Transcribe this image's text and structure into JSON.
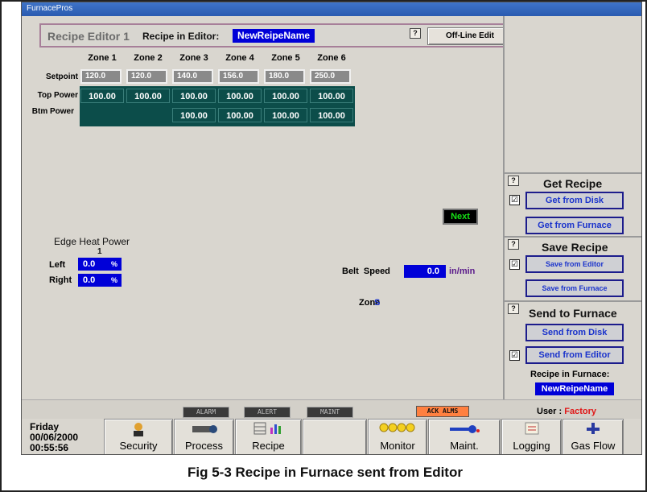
{
  "app": {
    "title": "FurnacePros"
  },
  "editor": {
    "title": "Recipe Editor 1",
    "recipe_label": "Recipe in Editor:",
    "recipe_name": "NewReipeName",
    "help": "?",
    "offline_button": "Off-Line Edit"
  },
  "zones": {
    "headers": [
      "Zone 1",
      "Zone 2",
      "Zone 3",
      "Zone 4",
      "Zone 5",
      "Zone 6"
    ],
    "row_labels": {
      "setpoint": "Setpoint",
      "top_power": "Top Power",
      "btm_power": "Btm Power"
    },
    "setpoint": [
      "120.0",
      "120.0",
      "140.0",
      "156.0",
      "180.0",
      "250.0"
    ],
    "top_power": [
      "100.00",
      "100.00",
      "100.00",
      "100.00",
      "100.00",
      "100.00"
    ],
    "btm_power": [
      "",
      "",
      "100.00",
      "100.00",
      "100.00",
      "100.00"
    ]
  },
  "next_button": "Next",
  "edge_heat": {
    "title": "Edge Heat Power",
    "number": "1",
    "left_label": "Left",
    "left_value": "0.0",
    "right_label": "Right",
    "right_value": "0.0",
    "unit": "%"
  },
  "belt": {
    "label": "Belt  Speed",
    "value": "0.0",
    "unit": "in/min"
  },
  "zone_s": {
    "label": "Zone",
    "value": "S"
  },
  "right_panel": {
    "get_recipe": {
      "title": "Get Recipe",
      "from_disk": "Get from Disk",
      "from_furnace": "Get from Furnace"
    },
    "save_recipe": {
      "title": "Save Recipe",
      "from_editor": "Save from Editor",
      "from_furnace": "Save from Furnace"
    },
    "send_recipe": {
      "title": "Send to Furnace",
      "from_disk": "Send from Disk",
      "from_editor": "Send from Editor"
    },
    "checkbox_mark": "☑",
    "recipe_in_furnace_label": "Recipe in Furnace:",
    "recipe_in_furnace_name": "NewReipeName"
  },
  "status": {
    "alarm": "ALARM",
    "alert": "ALERT",
    "maint": "MAINT",
    "ack": "ACK ALMS",
    "user_label": "User :",
    "user_name": "Factory"
  },
  "nav": {
    "day": "Friday",
    "date": "00/06/2000",
    "time": "00:55:56",
    "security": "Security",
    "process": "Process",
    "recipe": "Recipe",
    "monitor": "Monitor",
    "maint": "Maint.",
    "logging": "Logging",
    "gas_flow": "Gas Flow"
  },
  "caption": "Fig 5-3 Recipe in Furnace sent from Editor"
}
